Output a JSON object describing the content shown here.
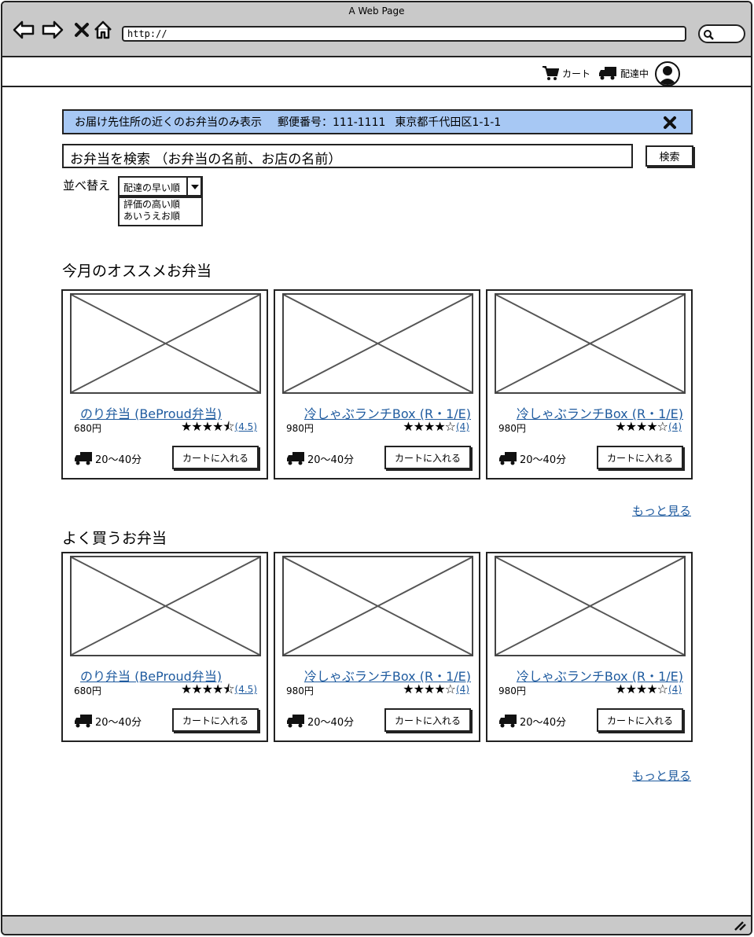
{
  "window": {
    "title": "A Web Page"
  },
  "browser": {
    "url": "http://"
  },
  "header": {
    "cart_label": "カート",
    "delivery_label": "配達中"
  },
  "banner": {
    "text": "お届け先住所の近くのお弁当のみ表示",
    "postal": "郵便番号：111-1111",
    "address": "東京都千代田区1-1-1"
  },
  "search": {
    "placeholder": "お弁当を検索 （お弁当の名前、お店の名前）",
    "button_label": "検索"
  },
  "sort": {
    "label": "並べ替え",
    "selected": "配達の早い順",
    "options": [
      "評価の高い順",
      "あいうえお順"
    ]
  },
  "sections": [
    {
      "title": "今月のオススメお弁当",
      "more_label": "もっと見る",
      "items": [
        {
          "name": "のり弁当 (BeProud弁当)",
          "price": "680円",
          "stars": "★★★★⯪",
          "rating": "(4.5)",
          "delivery": "20〜40分",
          "cart_label": "カートに入れる"
        },
        {
          "name": "冷しゃぶランチBox (R・1/E)",
          "price": "980円",
          "stars": "★★★★☆",
          "rating": "(4)",
          "delivery": "20〜40分",
          "cart_label": "カートに入れる"
        },
        {
          "name": "冷しゃぶランチBox (R・1/E)",
          "price": "980円",
          "stars": "★★★★☆",
          "rating": "(4)",
          "delivery": "20〜40分",
          "cart_label": "カートに入れる"
        }
      ]
    },
    {
      "title": "よく買うお弁当",
      "more_label": "もっと見る",
      "items": [
        {
          "name": "のり弁当 (BeProud弁当)",
          "price": "680円",
          "stars": "★★★★⯪",
          "rating": "(4.5)",
          "delivery": "20〜40分",
          "cart_label": "カートに入れる"
        },
        {
          "name": "冷しゃぶランチBox (R・1/E)",
          "price": "980円",
          "stars": "★★★★☆",
          "rating": "(4)",
          "delivery": "20〜40分",
          "cart_label": "カートに入れる"
        },
        {
          "name": "冷しゃぶランチBox (R・1/E)",
          "price": "980円",
          "stars": "★★★★☆",
          "rating": "(4)",
          "delivery": "20〜40分",
          "cart_label": "カートに入れる"
        }
      ]
    }
  ],
  "colors": {
    "banner_bg": "#a7c8f4",
    "link": "#1f5b9f",
    "chrome": "#c9c9c9"
  }
}
